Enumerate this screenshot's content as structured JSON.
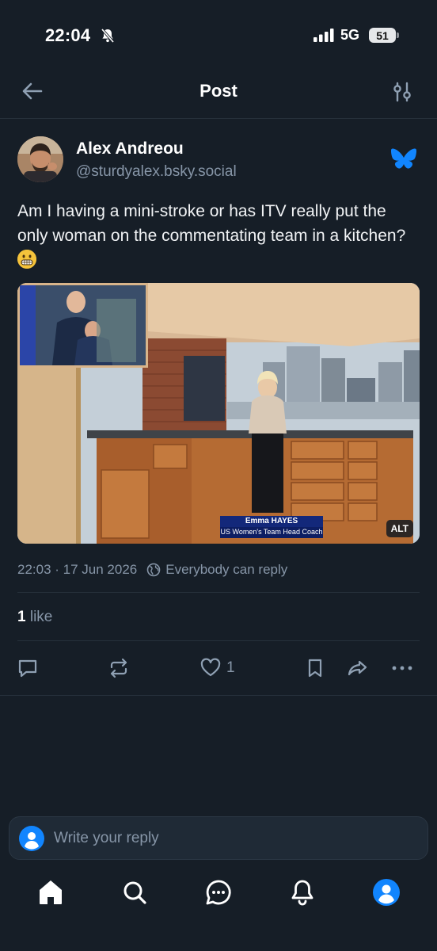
{
  "status": {
    "time": "22:04",
    "network": "5G",
    "battery": "51"
  },
  "header": {
    "title": "Post"
  },
  "post": {
    "author_name": "Alex Andreou",
    "author_handle": "@sturdyalex.bsky.social",
    "text": "Am I having a mini-stroke or has ITV really put the only woman on the commentating team in a kitchen?",
    "image": {
      "caption_name": "Emma HAYES",
      "caption_role": "US Women's Team Head Coach",
      "alt_badge": "ALT"
    },
    "timestamp": "22:03 · 17 Jun 2026",
    "reply_setting": "Everybody can reply",
    "likes_count": "1",
    "likes_label": "like",
    "action_like_count": "1"
  },
  "reply": {
    "placeholder": "Write your reply"
  },
  "icons": {
    "back": "arrow-left-icon",
    "filter": "sliders-icon",
    "verified": "bluesky-butterfly-icon",
    "reply": "comment-icon",
    "repost": "repost-icon",
    "like": "heart-icon",
    "bookmark": "bookmark-icon",
    "share": "share-icon",
    "more": "ellipsis-icon",
    "home": "home-icon",
    "search": "search-icon",
    "chat": "chat-icon",
    "notifications": "bell-icon",
    "profile": "profile-icon"
  },
  "colors": {
    "background": "#161e27",
    "accent": "#1185fe",
    "muted": "#8796a8"
  }
}
